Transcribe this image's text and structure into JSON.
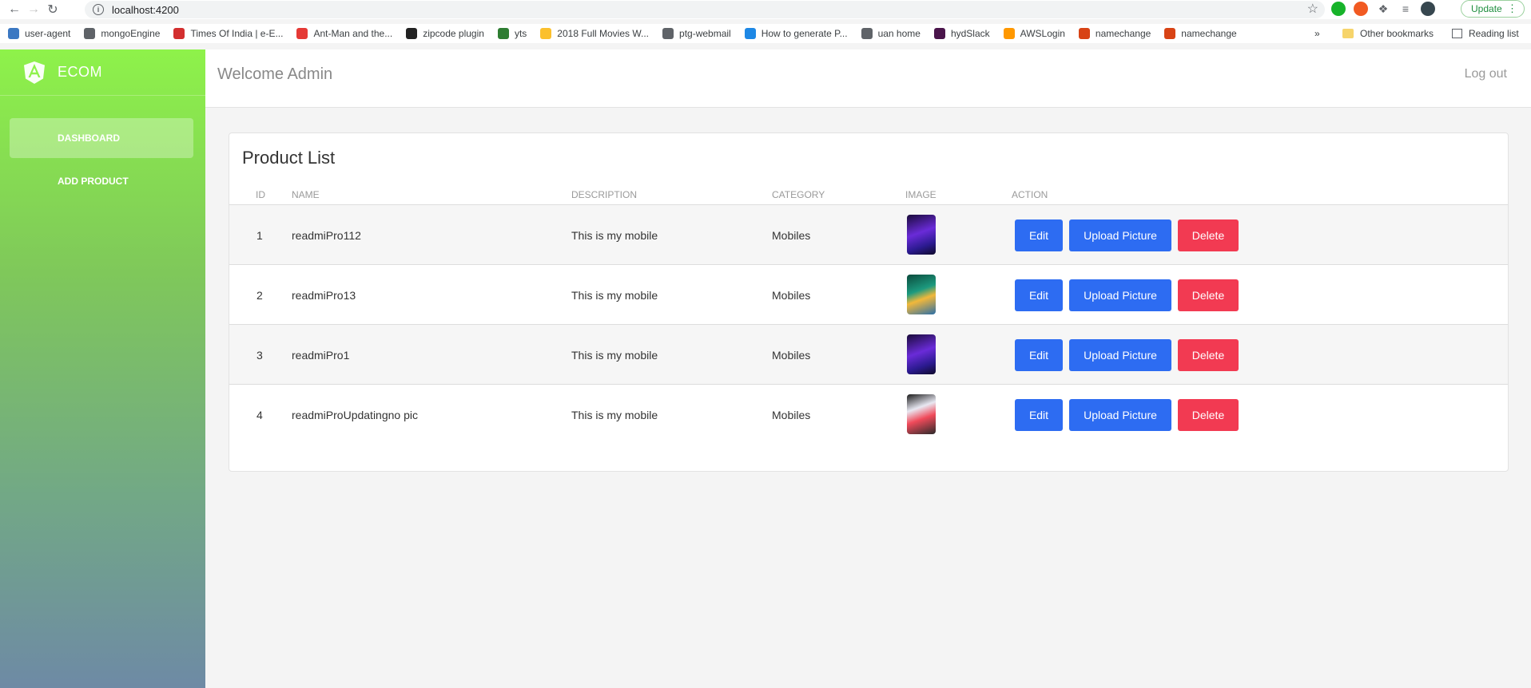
{
  "browser": {
    "url": "localhost:4200",
    "update_label": "Update",
    "bookmarks": [
      {
        "label": "user-agent",
        "color": "#3b78c2"
      },
      {
        "label": "mongoEngine",
        "color": "#5f6368"
      },
      {
        "label": "Times Of India | e-E...",
        "color": "#d32f2f"
      },
      {
        "label": "Ant-Man and the...",
        "color": "#e53935"
      },
      {
        "label": "zipcode plugin",
        "color": "#222222"
      },
      {
        "label": "yts",
        "color": "#2e7d32"
      },
      {
        "label": "2018 Full Movies W...",
        "color": "#fbc02d"
      },
      {
        "label": "ptg-webmail",
        "color": "#5f6368"
      },
      {
        "label": "How to generate P...",
        "color": "#1e88e5"
      },
      {
        "label": "uan home",
        "color": "#5f6368"
      },
      {
        "label": "hydSlack",
        "color": "#4a154b"
      },
      {
        "label": "AWSLogin",
        "color": "#ff9800"
      },
      {
        "label": "namechange",
        "color": "#d84315"
      },
      {
        "label": "namechange",
        "color": "#d84315"
      }
    ],
    "more_label": "»",
    "other_bookmarks": "Other bookmarks",
    "reading_list": "Reading list"
  },
  "brand": {
    "name": "ECOM"
  },
  "sidebar": {
    "items": [
      {
        "label": "DASHBOARD",
        "active": true
      },
      {
        "label": "ADD PRODUCT",
        "active": false
      }
    ]
  },
  "header": {
    "welcome": "Welcome Admin",
    "logout": "Log out"
  },
  "products": {
    "title": "Product List",
    "columns": [
      "ID",
      "NAME",
      "DESCRIPTION",
      "CATEGORY",
      "IMAGE",
      "ACTION"
    ],
    "rows": [
      {
        "id": "1",
        "name": "readmiPro112",
        "description": "This is my mobile",
        "category": "Mobiles",
        "image": "phone-purple"
      },
      {
        "id": "2",
        "name": "readmiPro13",
        "description": "This is my mobile",
        "category": "Mobiles",
        "image": "phone-green"
      },
      {
        "id": "3",
        "name": "readmiPro1",
        "description": "This is my mobile",
        "category": "Mobiles",
        "image": "phone-purple"
      },
      {
        "id": "4",
        "name": "readmiProUpdatingno pic",
        "description": "This is my mobile",
        "category": "Mobiles",
        "image": "phone-red"
      }
    ],
    "actions": {
      "edit": "Edit",
      "upload": "Upload Picture",
      "delete": "Delete"
    }
  }
}
